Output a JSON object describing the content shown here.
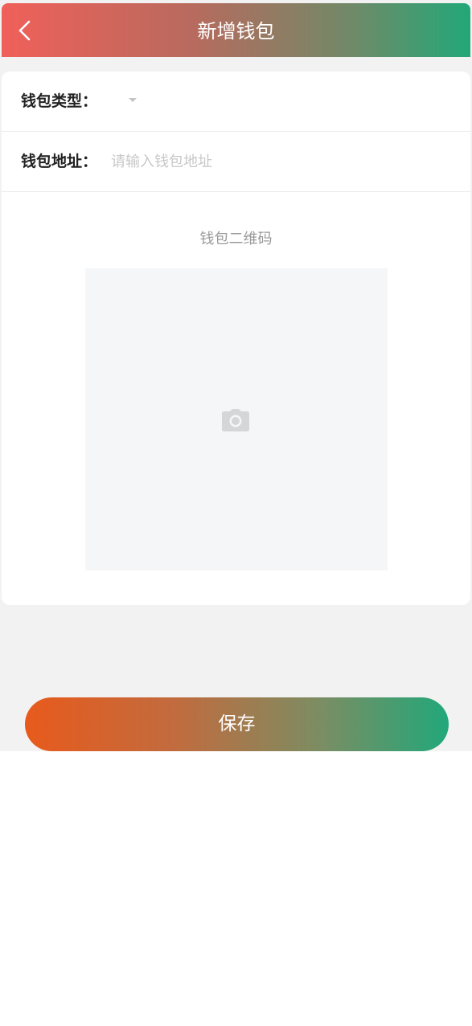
{
  "header": {
    "title": "新增钱包",
    "back_icon": "chevron-left-icon"
  },
  "form": {
    "wallet_type_label": "钱包类型：",
    "wallet_type_value": "",
    "wallet_address_label": "钱包地址：",
    "wallet_address_placeholder": "请输入钱包地址",
    "wallet_address_value": "",
    "qr_label": "钱包二维码",
    "qr_upload_icon": "camera-icon"
  },
  "actions": {
    "save_label": "保存"
  },
  "colors": {
    "header_gradient_start": "#f0605a",
    "header_gradient_end": "#22a878",
    "button_gradient_start": "#e85a1c",
    "button_gradient_end": "#21a87a",
    "page_background": "#f2f2f2"
  }
}
